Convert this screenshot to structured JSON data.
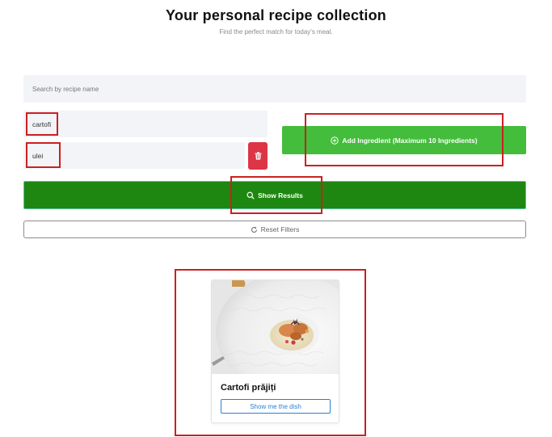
{
  "header": {
    "title": "Your personal recipe collection",
    "subtitle": "Find the perfect match for today's meal."
  },
  "search": {
    "placeholder": "Search by recipe name",
    "value": ""
  },
  "ingredients": [
    {
      "value": "cartofi"
    },
    {
      "value": "ulei"
    }
  ],
  "buttons": {
    "add_ingredient": "Add Ingredient (Maximum 10 Ingredients)",
    "show_results": "Show Results",
    "reset_filters": "Reset Filters"
  },
  "results": [
    {
      "title": "Cartofi prăjiți",
      "action_label": "Show me the dish"
    }
  ],
  "colors": {
    "add_button": "#43bd3b",
    "show_button": "#1e8711",
    "delete_button": "#dc3545",
    "card_button": "#2d7fd1",
    "highlight": "#cc2020"
  },
  "icons": {
    "add": "plus-circle-icon",
    "show": "search-icon",
    "reset": "refresh-icon",
    "delete": "trash-icon"
  }
}
